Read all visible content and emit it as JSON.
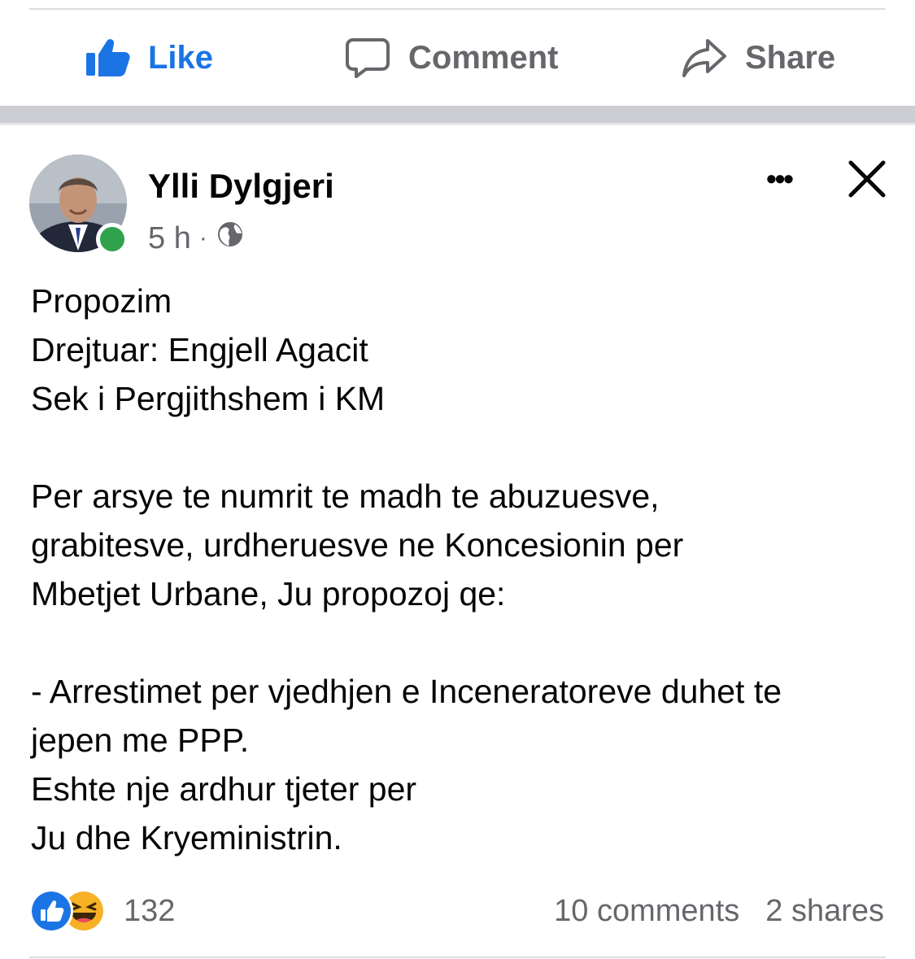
{
  "actions": {
    "like": "Like",
    "comment": "Comment",
    "share": "Share"
  },
  "post": {
    "author": "Ylli Dylgjeri",
    "time": "5 h",
    "separator": "·",
    "more_label": "•••",
    "lines": [
      "Propozim",
      "Drejtuar: Engjell Agacit",
      "Sek i Pergjithshem i KM",
      "",
      "Per arsye te numrit te madh te abuzuesve,",
      "grabitesve, urdheruesve ne Koncesionin per",
      "Mbetjet Urbane, Ju propozoj qe:",
      "",
      "- Arrestimet per vjedhjen e Inceneratoreve duhet te",
      "jepen me PPP.",
      "Eshte nje ardhur tjeter per",
      "Ju dhe Kryeministrin."
    ]
  },
  "footer": {
    "reaction_count": "132",
    "comments": "10 comments",
    "shares": "2 shares"
  },
  "colors": {
    "accent": "#1b74e4",
    "secondary_text": "#65676b",
    "online": "#31a24c",
    "haha": "#f7b125"
  },
  "icons": {
    "like": "thumbs-up-icon",
    "comment": "speech-bubble-icon",
    "share": "share-arrow-icon",
    "privacy": "globe-icon",
    "close": "close-icon",
    "more": "more-options-icon"
  }
}
